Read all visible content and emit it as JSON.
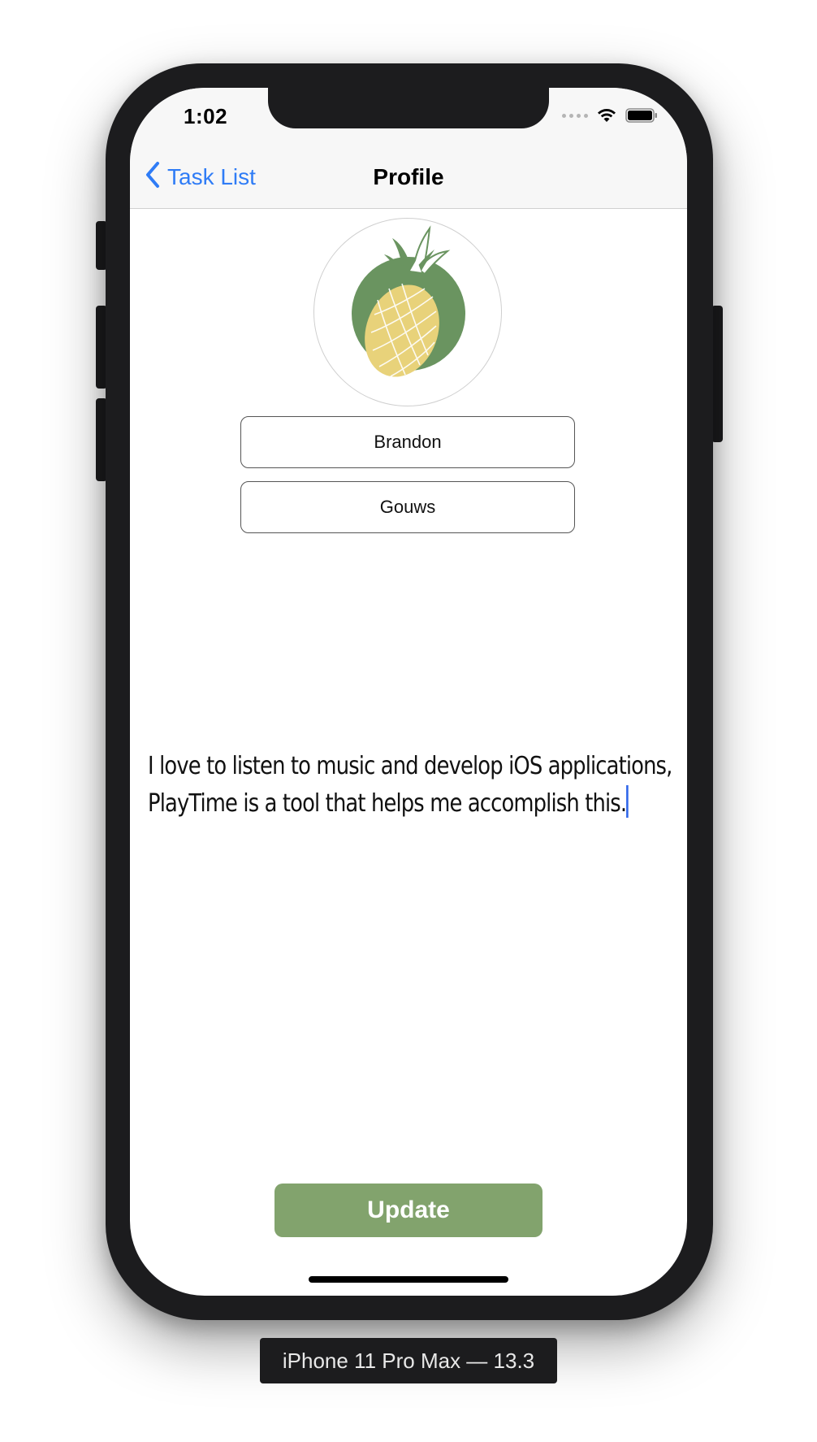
{
  "status_bar": {
    "time": "1:02",
    "icons": [
      "signal-dots-icon",
      "wifi-icon",
      "battery-icon"
    ]
  },
  "nav_bar": {
    "back_label": "Task List",
    "title": "Profile"
  },
  "profile": {
    "avatar_icon": "pineapple-icon",
    "first_name": "Brandon",
    "last_name": "Gouws",
    "bio_line1": "I love to listen to music and develop iOS applications,",
    "bio_line2": "PlayTime is a tool that helps me accomplish this."
  },
  "actions": {
    "update_label": "Update"
  },
  "simulator": {
    "device_label": "iPhone 11 Pro Max — 13.3"
  },
  "colors": {
    "accent_blue": "#2f7cf6",
    "update_green": "#82a36d",
    "avatar_green": "#6a9460",
    "pineapple_yellow": "#e8d27a"
  }
}
